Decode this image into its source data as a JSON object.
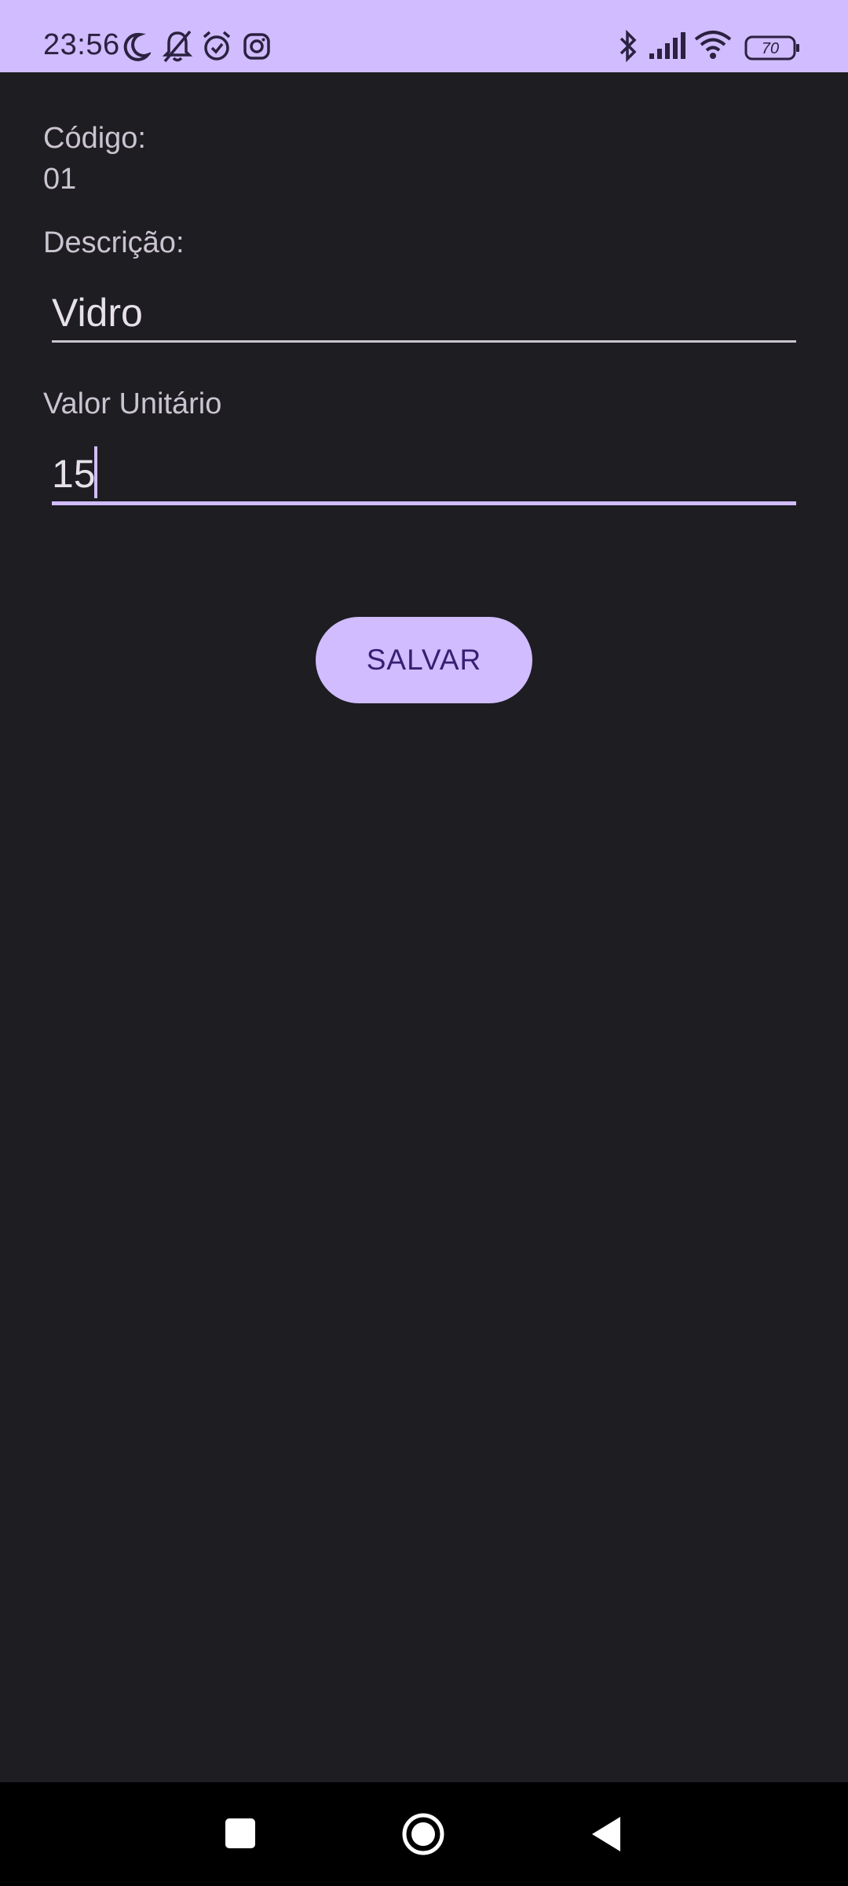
{
  "status_bar": {
    "time": "23:56",
    "battery": "70",
    "icons": [
      "moon-icon",
      "bell-off-icon",
      "alarm-icon",
      "instagram-icon",
      "bluetooth-icon",
      "signal-icon",
      "wifi-icon",
      "battery-icon"
    ]
  },
  "form": {
    "codigo_label": "Código:",
    "codigo_value": "01",
    "descricao_label": "Descrição:",
    "descricao_value": "Vidro",
    "valor_label": "Valor Unitário",
    "valor_value": "15",
    "save_label": "SALVAR"
  },
  "nav_bar": {
    "icons": [
      "recents-square-icon",
      "home-circle-icon",
      "back-triangle-icon"
    ]
  },
  "colors": {
    "accent": "#d0bcfe",
    "background": "#1e1d22",
    "button_text": "#381e72"
  }
}
